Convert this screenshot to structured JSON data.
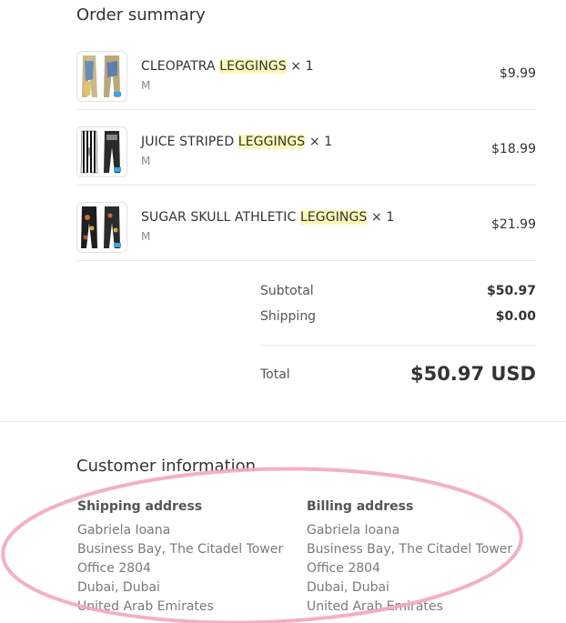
{
  "order_summary": {
    "title": "Order summary",
    "items": [
      {
        "name_prefix": "CLEOPATRA ",
        "name_highlight": "LEGGINGS",
        "quantity": "× 1",
        "variant": "M",
        "price": "$9.99"
      },
      {
        "name_prefix": "JUICE STRIPED ",
        "name_highlight": "LEGGINGS",
        "quantity": "× 1",
        "variant": "M",
        "price": "$18.99"
      },
      {
        "name_prefix": "SUGAR SKULL ATHLETIC ",
        "name_highlight": "LEGGINGS",
        "quantity": "× 1",
        "variant": "M",
        "price": "$21.99"
      }
    ],
    "subtotal_label": "Subtotal",
    "subtotal_value": "$50.97",
    "shipping_label": "Shipping",
    "shipping_value": "$0.00",
    "total_label": "Total",
    "total_value": "$50.97 USD"
  },
  "customer_information": {
    "title": "Customer information",
    "shipping": {
      "heading": "Shipping address",
      "lines": [
        "Gabriela Ioana",
        "Business Bay, The Citadel Tower",
        "Office 2804",
        "Dubai, Dubai",
        "United Arab Emirates"
      ]
    },
    "billing": {
      "heading": "Billing address",
      "lines": [
        "Gabriela Ioana",
        "Business Bay, The Citadel Tower",
        "Office 2804",
        "Dubai, Dubai",
        "United Arab Emirates"
      ]
    }
  },
  "colors": {
    "highlight": "#fdf7b8",
    "annotation_ellipse": "#f2a6c4",
    "divider": "#e6e6e6"
  }
}
